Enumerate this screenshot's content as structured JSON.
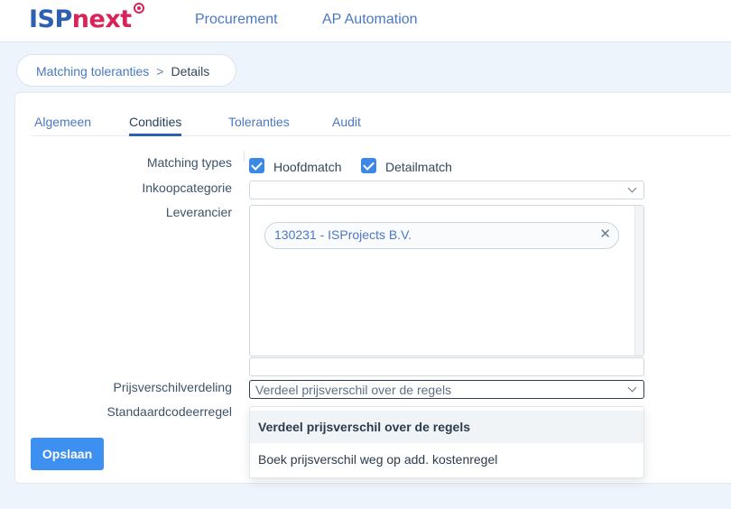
{
  "brand": {
    "part1": "ISP",
    "part2": "next"
  },
  "nav": [
    "Procurement",
    "AP Automation"
  ],
  "breadcrumb": {
    "parent": "Matching toleranties",
    "separator": ">",
    "current": "Details"
  },
  "tabs": [
    "Algemeen",
    "Condities",
    "Toleranties",
    "Audit"
  ],
  "active_tab": "Condities",
  "form": {
    "matching_types": {
      "label": "Matching types",
      "options": [
        "Hoofdmatch",
        "Detailmatch"
      ],
      "checked": [
        true,
        true
      ]
    },
    "inkoopcategorie": {
      "label": "Inkoopcategorie",
      "value": ""
    },
    "leverancier": {
      "label": "Leverancier",
      "selected": [
        "130231 - ISProjects B.V."
      ],
      "search_value": ""
    },
    "prijsverschilverdeling": {
      "label": "Prijsverschilverdeling",
      "value": "Verdeel prijsverschil over de regels",
      "options": [
        "Verdeel prijsverschil over de regels",
        "Boek prijsverschil weg op add. kostenregel"
      ]
    },
    "standaardcodeerregel": {
      "label": "Standaardcodeerregel"
    }
  },
  "save_label": "Opslaan",
  "colors": {
    "brand_blue": "#2e5fb1",
    "brand_pink": "#d8245a",
    "accent": "#3d8ff0",
    "link": "#4a78c2"
  }
}
